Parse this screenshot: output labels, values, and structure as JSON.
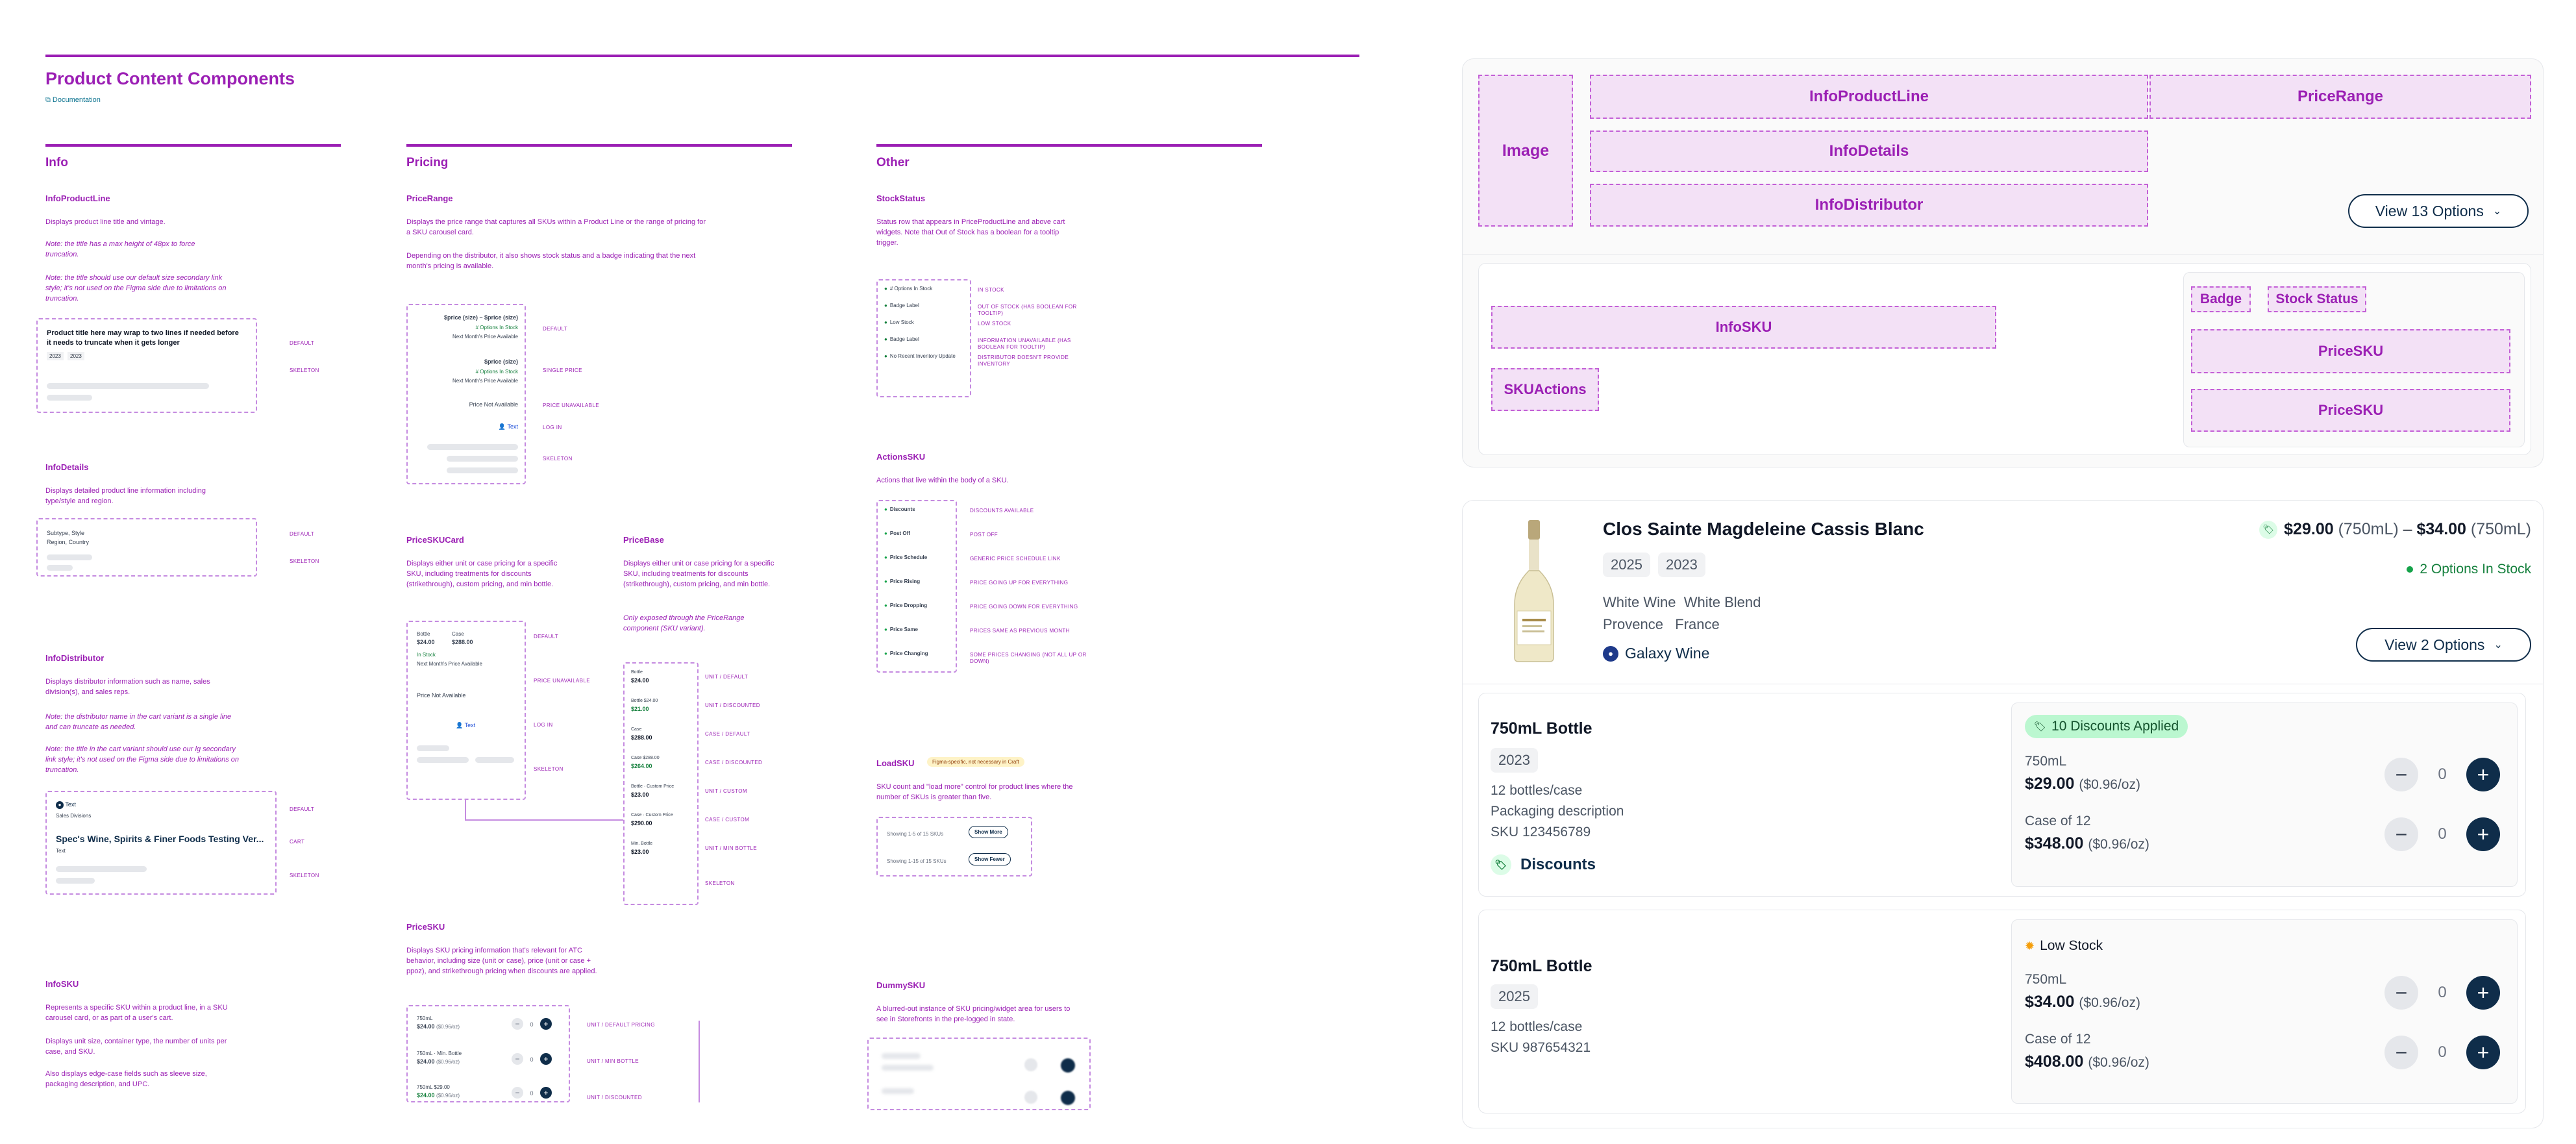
{
  "doc": {
    "title": "Product Content Components",
    "doc_link": "Documentation"
  },
  "sections": {
    "info": "Info",
    "pricing": "Pricing",
    "other": "Other"
  },
  "info": {
    "product_line": {
      "title": "InfoProductLine",
      "d1": "Displays product line title and vintage.",
      "d2": "Note: the title has a max height of 48px to force truncation.",
      "d3": "Note: the title should use our default size secondary link style; it's not used on the Figma side due to limitations on truncation.",
      "sample_title": "Product title here may wrap to two lines if needed before it needs to truncate when it gets longer",
      "chip1": "2023",
      "chip2": "2023",
      "l_default": "DEFAULT",
      "l_skeleton": "SKELETON"
    },
    "details": {
      "title": "InfoDetails",
      "d1": "Displays detailed product line information including type/style and region.",
      "row1": "Subtype, Style",
      "row2": "Region, Country",
      "l_default": "DEFAULT",
      "l_skeleton": "SKELETON"
    },
    "distributor": {
      "title": "InfoDistributor",
      "d1": "Displays distributor information such as name, sales division(s), and sales reps.",
      "d2": "Note: the distributor name in the cart variant is a single line and can truncate as needed.",
      "d3": "Note: the title in the cart variant should use our lg secondary link style; it's not used on the Figma side due to limitations on truncation.",
      "rep": "Text",
      "division": "Sales Divisions",
      "name": "Spec's Wine, Spirits & Finer Foods Testing Ver...",
      "sub": "Text",
      "l_default": "DEFAULT",
      "l_cart": "CART",
      "l_skeleton": "SKELETON"
    },
    "sku": {
      "title": "InfoSKU",
      "d1": "Represents a specific SKU within a product line, in a SKU carousel card, or as part of a user's cart.",
      "d2": "Displays unit size, container type, the number of units per case, and SKU.",
      "d3": "Also displays edge-case fields such as sleeve size, packaging description, and UPC."
    }
  },
  "pricing": {
    "range": {
      "title": "PriceRange",
      "d1": "Displays the price range that captures all SKUs within a Product Line or the range of pricing for a SKU carousel card.",
      "d2": "Depending on the distributor, it also shows stock status and a badge indicating that the next month's pricing is available.",
      "r1_price": "$price (size) – $price (size)",
      "r1_stock": "# Options In Stock",
      "r1_next": "Next Month's Price Available",
      "r2_price": "$price (size)",
      "r2_stock": "# Options In Stock",
      "r2_next": "Next Month's Price Available",
      "r3": "Price Not Available",
      "r4": "Text",
      "l_default": "DEFAULT",
      "l_single": "SINGLE PRICE",
      "l_unavail": "PRICE UNAVAILABLE",
      "l_login": "LOG IN",
      "l_skeleton": "SKELETON"
    },
    "skucard": {
      "title": "PriceSKUCard",
      "d1": "Displays either unit or case pricing for a specific SKU, including treatments for discounts (strikethrough), custom pricing, and min bottle.",
      "bottle_lbl": "Bottle",
      "bottle_val": "$24.00",
      "case_lbl": "Case",
      "case_val": "$288.00",
      "stock": "In Stock",
      "next": "Next Month's Price Available",
      "unavail": "Price Not Available",
      "login": "Text",
      "l_default": "DEFAULT",
      "l_unavail": "PRICE UNAVAILABLE",
      "l_login": "LOG IN",
      "l_skeleton": "SKELETON"
    },
    "base": {
      "title": "PriceBase",
      "d1": "Displays either unit or case pricing for a specific SKU, including treatments for discounts (strikethrough), custom pricing, and min bottle.",
      "d2": "Only exposed through the PriceRange component (SKU variant).",
      "rows": [
        {
          "lbl": "Bottle",
          "val": "$24.00",
          "tag": "UNIT / DEFAULT"
        },
        {
          "lbl": "Bottle $24.00",
          "val": "$21.00",
          "tag": "UNIT / DISCOUNTED"
        },
        {
          "lbl": "Case",
          "val": "$288.00",
          "tag": "CASE / DEFAULT"
        },
        {
          "lbl": "Case $288.00",
          "val": "$264.00",
          "tag": "CASE / DISCOUNTED"
        },
        {
          "lbl": "Bottle · Custom Price",
          "val": "$23.00",
          "tag": "UNIT / CUSTOM"
        },
        {
          "lbl": "Case · Custom Price",
          "val": "$290.00",
          "tag": "CASE / CUSTOM"
        },
        {
          "lbl": "Min. Bottle",
          "val": "$23.00",
          "tag": "UNIT / MIN BOTTLE"
        }
      ],
      "l_skeleton": "SKELETON"
    },
    "sku": {
      "title": "PriceSKU",
      "d1": "Displays SKU pricing information that's relevant for ATC behavior, including size (unit or case), price (unit or case + ppoz), and strikethrough pricing when discounts are applied.",
      "r1_size": "750mL",
      "r1_price": "$24.00",
      "r1_ppoz": "($0.96/oz)",
      "r2_size": "750mL · Min. Bottle",
      "r2_price": "$24.00",
      "r2_ppoz": "($0.96/oz)",
      "r3_size": "750mL $29.00",
      "r3_price": "$24.00",
      "r3_ppoz": "($0.96/oz)",
      "l1": "UNIT / DEFAULT PRICING",
      "l2": "UNIT / MIN BOTTLE",
      "l3": "UNIT / DISCOUNTED"
    }
  },
  "other": {
    "stock": {
      "title": "StockStatus",
      "d1": "Status row that appears in PriceProductLine and above cart widgets. Note that Out of Stock has a boolean for a tooltip trigger.",
      "rows": [
        {
          "txt": "# Options In Stock",
          "tag": "IN STOCK"
        },
        {
          "txt": "Badge Label",
          "tag": "OUT OF STOCK (HAS BOOLEAN FOR TOOLTIP)"
        },
        {
          "txt": "Low Stock",
          "tag": "LOW STOCK"
        },
        {
          "txt": "Badge Label",
          "tag": "INFORMATION UNAVAILABLE (HAS BOOLEAN FOR TOOLTIP)"
        },
        {
          "txt": "No Recent Inventory Update",
          "tag": "DISTRIBUTOR DOESN'T PROVIDE INVENTORY"
        }
      ]
    },
    "actions": {
      "title": "ActionsSKU",
      "d1": "Actions that live within the body of a SKU.",
      "rows": [
        {
          "txt": "Discounts",
          "tag": "DISCOUNTS AVAILABLE"
        },
        {
          "txt": "Post Off",
          "tag": "POST OFF"
        },
        {
          "txt": "Price Schedule",
          "tag": "GENERIC PRICE SCHEDULE LINK"
        },
        {
          "txt": "Price Rising",
          "tag": "PRICE GOING UP FOR EVERYTHING"
        },
        {
          "txt": "Price Dropping",
          "tag": "PRICE GOING DOWN FOR EVERYTHING"
        },
        {
          "txt": "Price Same",
          "tag": "PRICES SAME AS PREVIOUS MONTH"
        },
        {
          "txt": "Price Changing",
          "tag": "SOME PRICES CHANGING (NOT ALL UP OR DOWN)"
        }
      ]
    },
    "load": {
      "title": "LoadSKU",
      "badge": "Figma-specific, not necessary in Craft",
      "d1": "SKU count and \"load more\" control for product lines where the number of SKUs is greater than five.",
      "r1": "Showing 1-5 of 15 SKUs",
      "b1": "Show More",
      "r2": "Showing 1-15 of 15 SKUs",
      "b2": "Show Fewer"
    },
    "dummy": {
      "title": "DummySKU",
      "d1": "A blurred-out instance of SKU pricing/widget area for users to see in Storefronts in the pre-logged in state."
    }
  },
  "layout_card": {
    "image": "Image",
    "info_product_line": "InfoProductLine",
    "price_range": "PriceRange",
    "info_details": "InfoDetails",
    "info_distributor": "InfoDistributor",
    "view_options": "View 13 Options",
    "info_sku": "InfoSKU",
    "badge": "Badge",
    "stock_status": "Stock Status",
    "price_sku_1": "PriceSKU",
    "price_sku_2": "PriceSKU",
    "sku_actions": "SKUActions"
  },
  "product": {
    "title": "Clos Sainte Magdeleine Cassis Blanc",
    "vintages": [
      "2025",
      "2023"
    ],
    "type": "White Wine",
    "style": "White Blend",
    "region": "Provence",
    "country": "France",
    "distributor": "Galaxy Wine",
    "price_low": "$29.00",
    "size_low": "(750mL)",
    "dash": "–",
    "price_high": "$34.00",
    "size_high": "(750mL)",
    "stock": "2 Options In Stock",
    "view_options": "View 2 Options"
  },
  "skus": [
    {
      "name": "750mL Bottle",
      "vintage": "2023",
      "case": "12 bottles/case",
      "packaging": "Packaging description",
      "sku": "SKU 123456789",
      "action": "Discounts",
      "badge": "10 Discounts Applied",
      "p1_size": "750mL",
      "p1_price": "$29.00",
      "p1_ppoz": "($0.96/oz)",
      "p1_qty": "0",
      "p2_size": "Case of 12",
      "p2_price": "$348.00",
      "p2_ppoz": "($0.96/oz)",
      "p2_qty": "0"
    },
    {
      "name": "750mL Bottle",
      "vintage": "2025",
      "case": "12 bottles/case",
      "sku": "SKU 987654321",
      "badge": "Low Stock",
      "p1_size": "750mL",
      "p1_price": "$34.00",
      "p1_ppoz": "($0.96/oz)",
      "p1_qty": "0",
      "p2_size": "Case of 12",
      "p2_price": "$408.00",
      "p2_ppoz": "($0.96/oz)",
      "p2_qty": "0"
    }
  ],
  "colors": {
    "accent": "#9b1fb4",
    "navy": "#0f2d4a",
    "green": "#16a34a"
  }
}
